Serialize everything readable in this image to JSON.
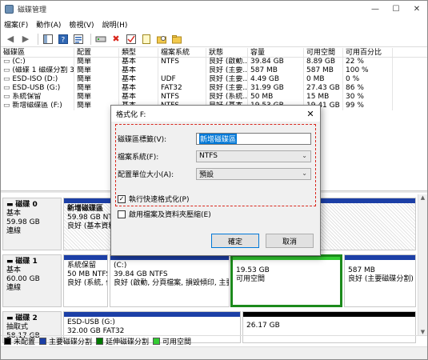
{
  "window": {
    "title": "磁碟管理",
    "minimize": "—",
    "maximize": "☐",
    "close": "✕"
  },
  "menu": [
    "檔案(F)",
    "動作(A)",
    "檢視(V)",
    "說明(H)"
  ],
  "toolbar": [
    "back-arrow-icon",
    "forward-arrow-icon",
    "sep",
    "panel-icon",
    "help-icon",
    "properties-icon",
    "sep",
    "connect-icon",
    "delete-icon",
    "check-icon",
    "new-icon",
    "folder-search-icon",
    "folder-open-icon"
  ],
  "volume_table": {
    "headers": [
      "磁碟區",
      "配置",
      "類型",
      "檔案系統",
      "狀態",
      "容量",
      "可用空間",
      "可用百分比",
      ""
    ],
    "rows": [
      [
        "(C:)",
        "簡單",
        "基本",
        "NTFS",
        "良好 (啟動...",
        "39.84 GB",
        "8.89 GB",
        "22 %"
      ],
      [
        "(磁碟 1 磁碟分割 3)",
        "簡單",
        "基本",
        "",
        "良好 (主要...",
        "587 MB",
        "587 MB",
        "100 %"
      ],
      [
        "ESD-ISO (D:)",
        "簡單",
        "基本",
        "UDF",
        "良好 (主要...",
        "4.49 GB",
        "0 MB",
        "0 %"
      ],
      [
        "ESD-USB (G:)",
        "簡單",
        "基本",
        "FAT32",
        "良好 (主要...",
        "31.99 GB",
        "27.43 GB",
        "86 %"
      ],
      [
        "系統保留",
        "簡單",
        "基本",
        "NTFS",
        "良好 (系統...",
        "50 MB",
        "15 MB",
        "30 %"
      ],
      [
        "新增磁碟區 (F:)",
        "簡單",
        "基本",
        "NTFS",
        "良好 (基本...",
        "19.53 GB",
        "19.41 GB",
        "99 %"
      ]
    ]
  },
  "disks": [
    {
      "name": "磁碟 0",
      "type": "基本",
      "size": "59.98 GB",
      "status": "連線",
      "partitions": [
        {
          "name": "新增磁碟區",
          "line2": "59.98 GB NTFS",
          "line3": "良好 (基本資料分割)"
        }
      ]
    },
    {
      "name": "磁碟 1",
      "type": "基本",
      "size": "60.00 GB",
      "status": "連線",
      "partitions": [
        {
          "name": "系統保留",
          "line2": "50 MB NTFS",
          "line3": "良好 (系統, 作..."
        },
        {
          "name": "(C:)",
          "line2": "39.84 GB NTFS",
          "line3": "良好 (啟動, 分頁檔案, 損毀傾印, 主要磁碟"
        },
        {
          "name": "",
          "line2": "19.53 GB",
          "line3": "可用空間"
        },
        {
          "name": "",
          "line2": "587 MB",
          "line3": "良好 (主要磁碟分割)"
        }
      ]
    },
    {
      "name": "磁碟 2",
      "type": "抽取式",
      "size": "58.17 GB",
      "status": "",
      "partitions": [
        {
          "name": "ESD-USB (G:)",
          "line2": "32.00 GB FAT32",
          "line3": ""
        },
        {
          "name": "",
          "line2": "26.17 GB",
          "line3": ""
        }
      ]
    }
  ],
  "legend": [
    {
      "label": "未配置",
      "color": "#000000"
    },
    {
      "label": "主要磁碟分割",
      "color": "#1c3fa6"
    },
    {
      "label": "延伸磁碟分割",
      "color": "#007a00"
    },
    {
      "label": "可用空間",
      "color": "#33cc33"
    }
  ],
  "dialog": {
    "title": "格式化 F:",
    "volume_label": "磁碟區標籤(V):",
    "volume_value": "新增磁碟區",
    "fs_label": "檔案系統(F):",
    "fs_value": "NTFS",
    "alloc_label": "配置單位大小(A):",
    "alloc_value": "預設",
    "quick_format": "執行快速格式化(P)",
    "quick_format_checked": true,
    "compression": "啟用檔案及資料夾壓縮(E)",
    "compression_checked": false,
    "ok": "確定",
    "cancel": "取消",
    "close": "✕",
    "checkmark": "✓",
    "dropdown_arrow": "⌄"
  },
  "colors": {
    "primary": "#1c3fa6",
    "free": "#33cc33",
    "highlight": "#d9281e",
    "selection": "#0078d7"
  }
}
